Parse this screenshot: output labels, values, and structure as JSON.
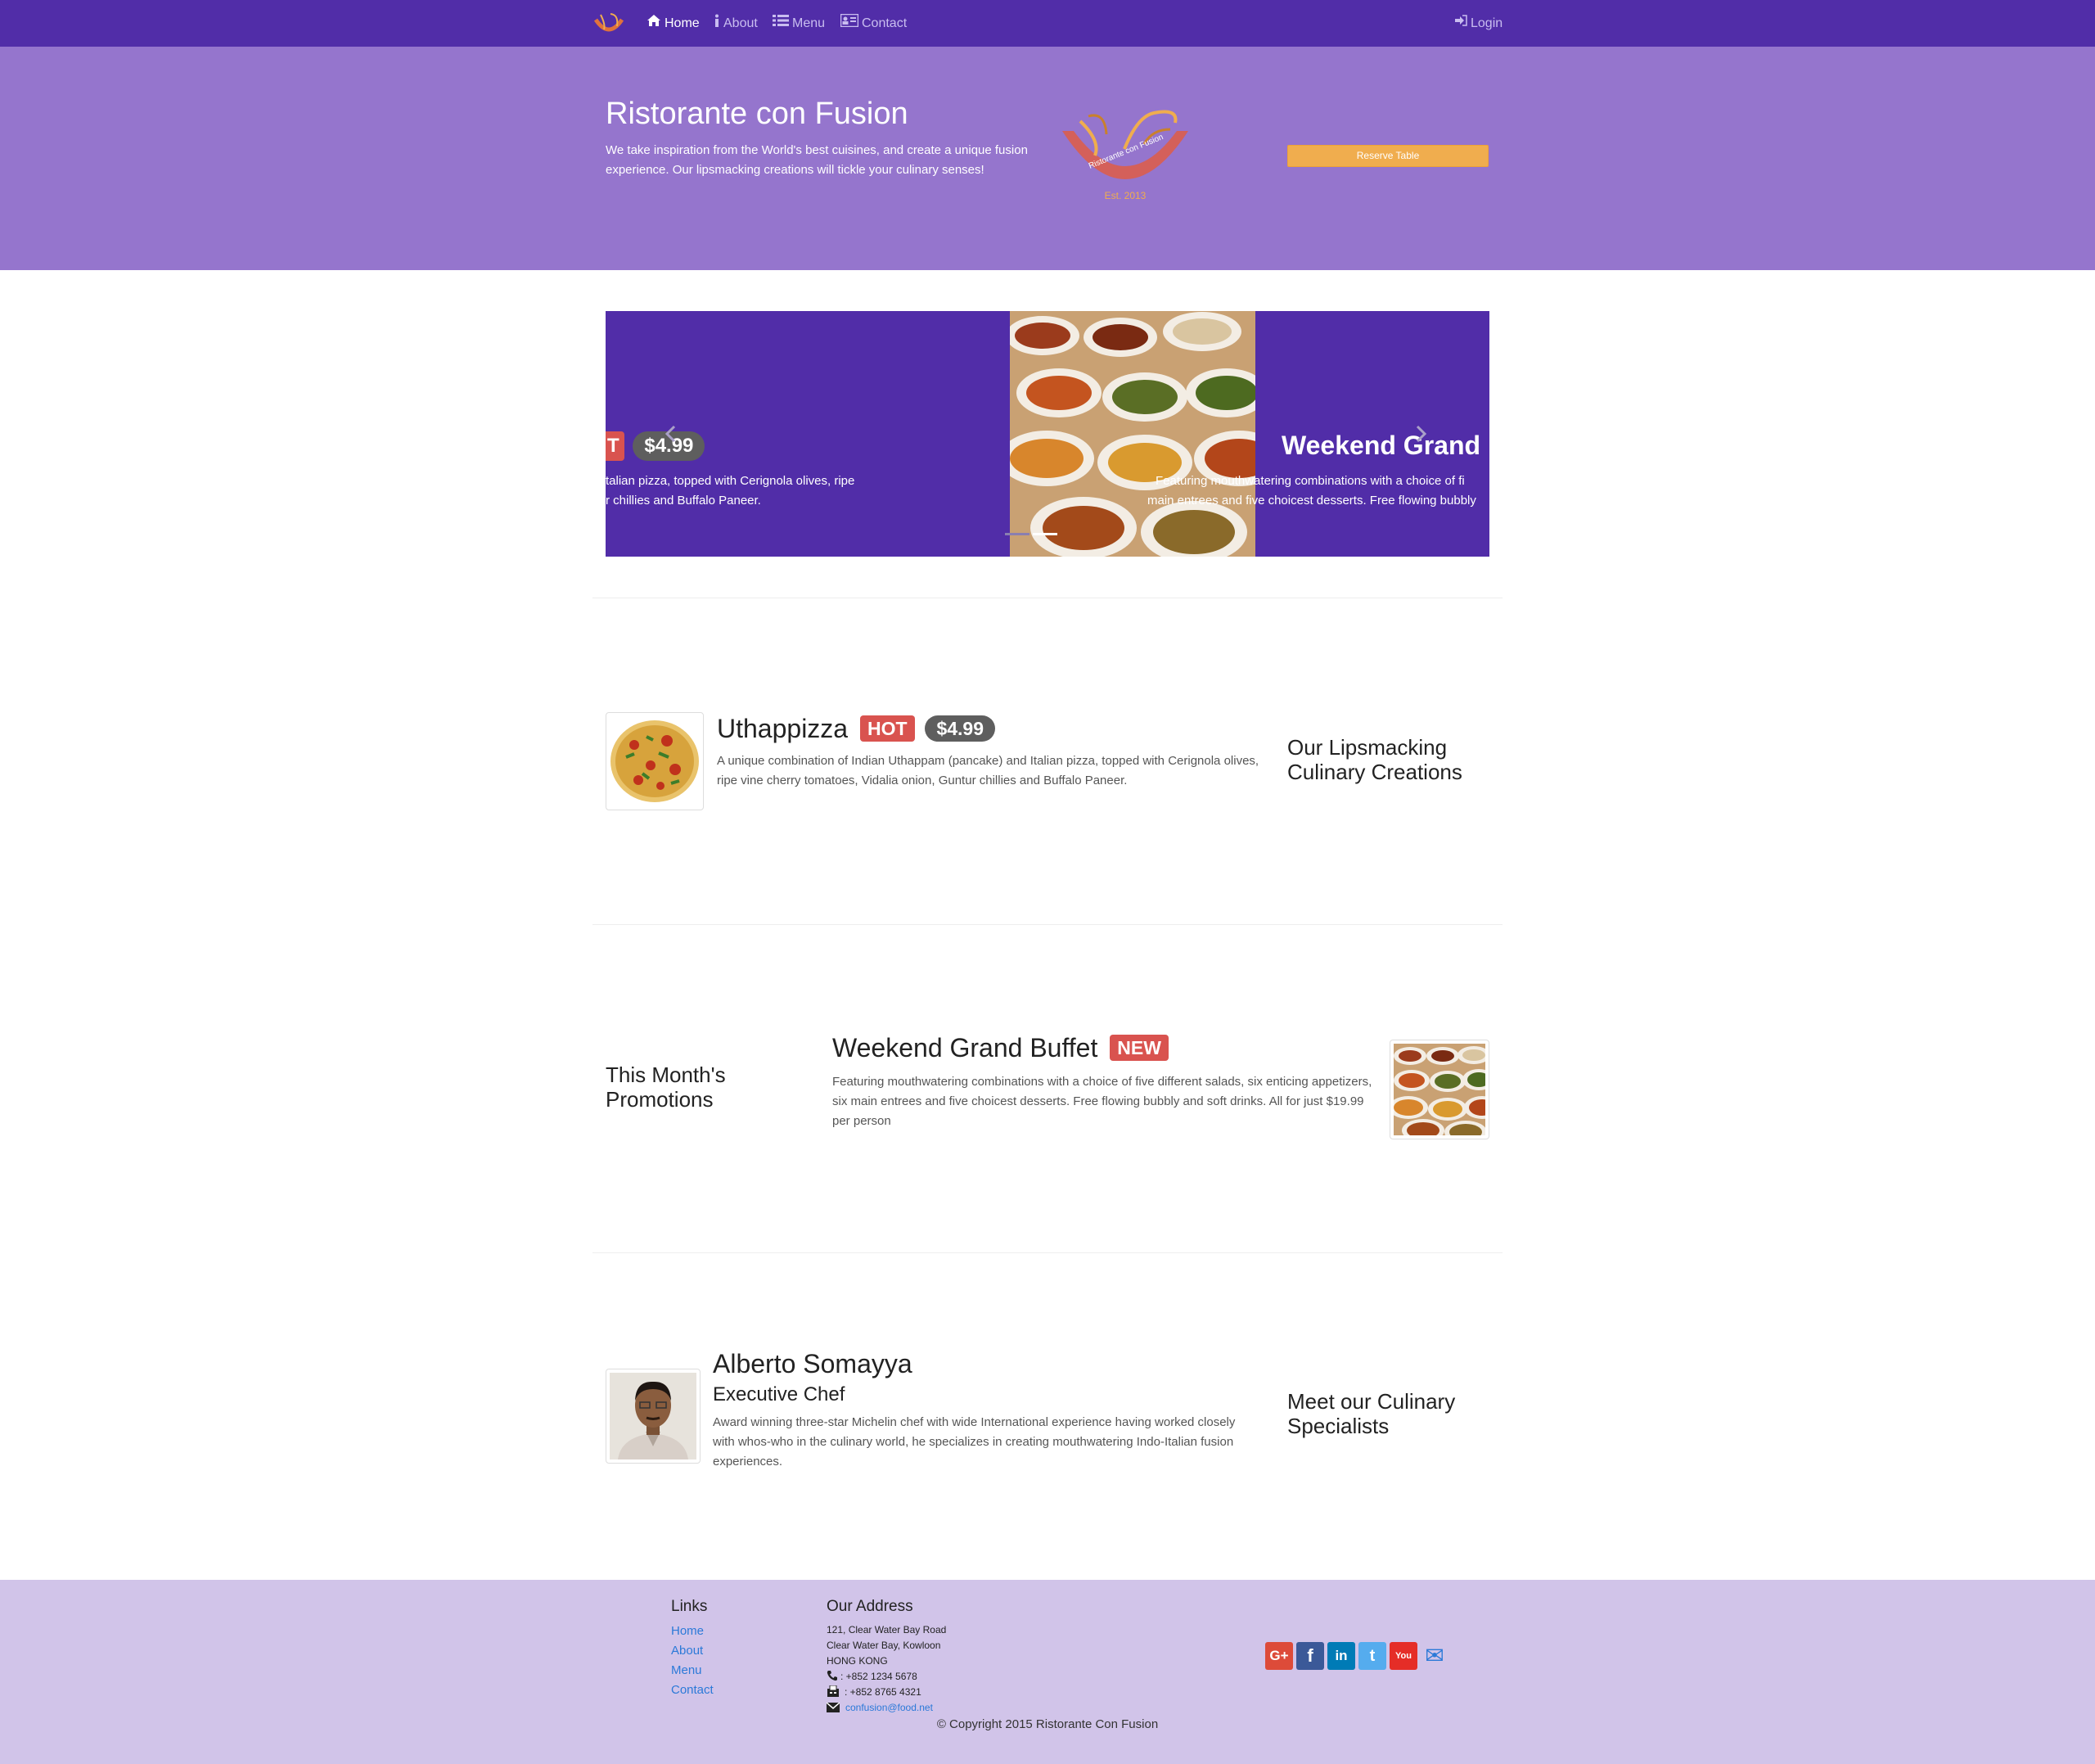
{
  "navbar": {
    "brand_icon": "restaurant-logo-icon",
    "items": [
      {
        "label": "Home",
        "icon": "home-icon",
        "active": true
      },
      {
        "label": "About",
        "icon": "info-icon",
        "active": false
      },
      {
        "label": "Menu",
        "icon": "list-icon",
        "active": false
      },
      {
        "label": "Contact",
        "icon": "address-card-icon",
        "active": false
      }
    ],
    "login": {
      "label": "Login",
      "icon": "sign-in-icon"
    }
  },
  "jumbotron": {
    "title": "Ristorante con Fusion",
    "text": "We take inspiration from the World's best cuisines, and create a unique fusion experience. Our lipsmacking creations will tickle your culinary senses!",
    "logo_text": "Ristorante con Fusion",
    "logo_est": "Est. 2013",
    "reserve_label": "Reserve Table"
  },
  "carousel": {
    "left_badge_hot": "T",
    "left_badge_price": "$4.99",
    "left_caption_line1": "talian pizza, topped with Cerignola olives, ripe",
    "left_caption_line2": "r chillies and Buffalo Paneer.",
    "right_title": "Weekend Grand B",
    "right_caption_line1": "Featuring mouthwatering combinations with a choice of fi",
    "right_caption_line2": "main entrees and five choicest desserts. Free flowing bubbly",
    "prev_icon": "chevron-left-icon",
    "next_icon": "chevron-right-icon"
  },
  "dish": {
    "title": "Uthappizza",
    "badge_hot": "HOT",
    "price": "$4.99",
    "description": "A unique combination of Indian Uthappam (pancake) and Italian pizza, topped with Cerignola olives, ripe vine cherry tomatoes, Vidalia onion, Guntur chillies and Buffalo Paneer.",
    "side_title": "Our Lipsmacking Culinary Creations"
  },
  "promotion": {
    "side_title": "This Month's Promotions",
    "title": "Weekend Grand Buffet",
    "badge_new": "NEW",
    "description": "Featuring mouthwatering combinations with a choice of five different salads, six enticing appetizers, six main entrees and five choicest desserts. Free flowing bubbly and soft drinks. All for just $19.99 per person"
  },
  "leader": {
    "name": "Alberto Somayya",
    "designation": "Executive Chef",
    "description": "Award winning three-star Michelin chef with wide International experience having worked closely with whos-who in the culinary world, he specializes in creating mouthwatering Indo-Italian fusion experiences.",
    "side_title": "Meet our Culinary Specialists"
  },
  "footer": {
    "links_heading": "Links",
    "links": [
      "Home",
      "About",
      "Menu",
      "Contact"
    ],
    "address_heading": "Our Address",
    "address_lines": [
      "121, Clear Water Bay Road",
      "Clear Water Bay, Kowloon",
      "HONG KONG"
    ],
    "phone": ": +852 1234 5678",
    "fax": ": +852 8765 4321",
    "email": "confusion@food.net",
    "copyright": "© Copyright 2015 Ristorante Con Fusion",
    "social": [
      {
        "icon": "google-plus-icon",
        "glyph": "G+",
        "color": "#dd4b39"
      },
      {
        "icon": "facebook-icon",
        "glyph": "f",
        "color": "#3b5998"
      },
      {
        "icon": "linkedin-icon",
        "glyph": "in",
        "color": "#007bb6"
      },
      {
        "icon": "twitter-icon",
        "glyph": "t",
        "color": "#55acee"
      },
      {
        "icon": "youtube-icon",
        "glyph": "You",
        "color": "#e52d27"
      },
      {
        "icon": "mail-icon",
        "glyph": "✉",
        "color": "#2b79d8"
      }
    ]
  }
}
